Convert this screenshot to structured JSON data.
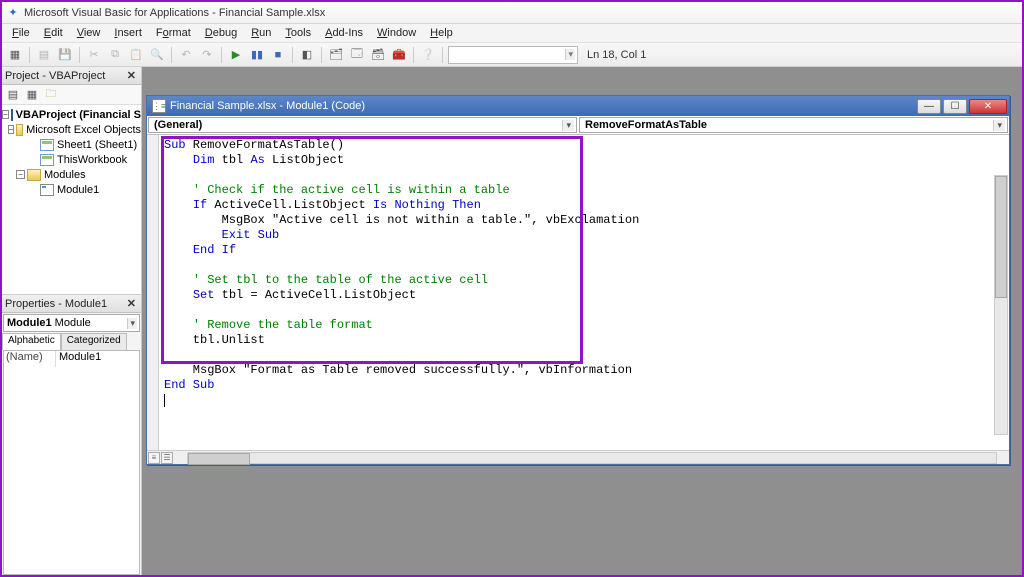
{
  "app": {
    "title": "Microsoft Visual Basic for Applications - Financial Sample.xlsx"
  },
  "menu": [
    "File",
    "Edit",
    "View",
    "Insert",
    "Format",
    "Debug",
    "Run",
    "Tools",
    "Add-Ins",
    "Window",
    "Help"
  ],
  "toolbar": {
    "status": "Ln 18, Col 1"
  },
  "projectPanel": {
    "title": "Project - VBAProject",
    "root": "VBAProject (Financial Sample.xlsx)",
    "excelFolder": "Microsoft Excel Objects",
    "sheet1": "Sheet1 (Sheet1)",
    "thisWb": "ThisWorkbook",
    "modulesFolder": "Modules",
    "module1": "Module1"
  },
  "propsPanel": {
    "title": "Properties - Module1",
    "combo": "Module1 Module",
    "tabA": "Alphabetic",
    "tabB": "Categorized",
    "nameKey": "(Name)",
    "nameVal": "Module1"
  },
  "codeWindow": {
    "title": "Financial Sample.xlsx - Module1 (Code)",
    "leftCombo": "(General)",
    "rightCombo": "RemoveFormatAsTable"
  },
  "code": {
    "l1a": "Sub",
    "l1b": " RemoveFormatAsTable()",
    "l2a": "    ",
    "l2b": "Dim",
    "l2c": " tbl ",
    "l2d": "As",
    "l2e": " ListObject",
    "l4a": "    ",
    "l4b": "' Check if the active cell is within a table",
    "l5a": "    ",
    "l5b": "If",
    "l5c": " ActiveCell.ListObject ",
    "l5d": "Is",
    "l5e": " ",
    "l5f": "Nothing",
    "l5g": " ",
    "l5h": "Then",
    "l6": "        MsgBox \"Active cell is not within a table.\", vbExclamation",
    "l7a": "        ",
    "l7b": "Exit Sub",
    "l8a": "    ",
    "l8b": "End If",
    "l10a": "    ",
    "l10b": "' Set tbl to the table of the active cell",
    "l11a": "    ",
    "l11b": "Set",
    "l11c": " tbl = ActiveCell.ListObject",
    "l13a": "    ",
    "l13b": "' Remove the table format",
    "l14": "    tbl.Unlist",
    "l16": "    MsgBox \"Format as Table removed successfully.\", vbInformation",
    "l17": "End Sub"
  }
}
